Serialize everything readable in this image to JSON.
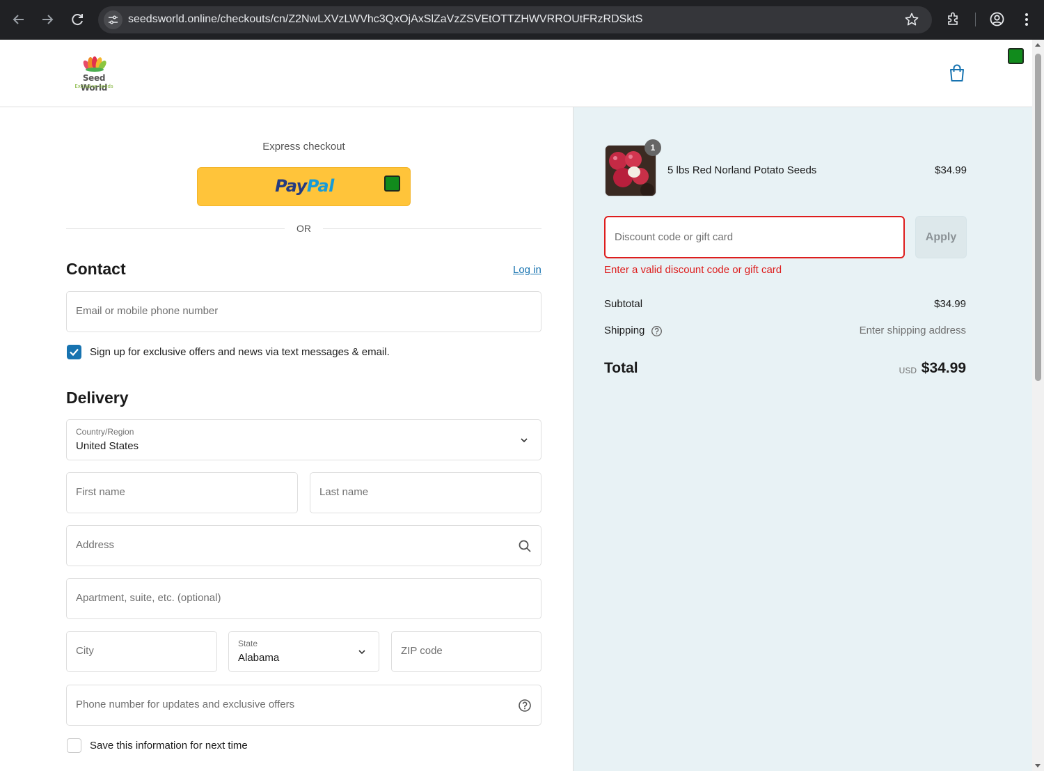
{
  "browser": {
    "url": "seedsworld.online/checkouts/cn/Z2NwLXVzLWVhc3QxOjAxSlZaVzZSVEtOTTZHWVRROUtFRzRDSktS",
    "icons": [
      "back-icon",
      "forward-icon",
      "reload-icon",
      "site-info-icon",
      "star-icon",
      "extensions-icon",
      "profile-icon",
      "menu-icon"
    ]
  },
  "brand": {
    "name": "Seed World",
    "tagline": "Exclusive seeds",
    "accent": "#1773b0",
    "error": "#dd1d1d"
  },
  "express": {
    "title": "Express checkout",
    "paypal_part1": "Pay",
    "paypal_part2": "Pal",
    "divider": "OR"
  },
  "contact": {
    "title": "Contact",
    "login_label": "Log in",
    "email_placeholder": "Email or mobile phone number",
    "marketing_label": "Sign up for exclusive offers and news via text messages & email.",
    "marketing_checked": true
  },
  "delivery": {
    "title": "Delivery",
    "country_label": "Country/Region",
    "country_value": "United States",
    "first_name_placeholder": "First name",
    "last_name_placeholder": "Last name",
    "address_placeholder": "Address",
    "apartment_placeholder": "Apartment, suite, etc. (optional)",
    "city_placeholder": "City",
    "state_label": "State",
    "state_value": "Alabama",
    "zip_placeholder": "ZIP code",
    "phone_placeholder": "Phone number for updates and exclusive offers",
    "save_label": "Save this information for next time",
    "save_checked": false
  },
  "summary": {
    "product": {
      "name": "5 lbs Red Norland Potato Seeds",
      "price": "$34.99",
      "quantity": "1"
    },
    "discount_placeholder": "Discount code or gift card",
    "apply_label": "Apply",
    "error_message": "Enter a valid discount code or gift card",
    "subtotal_label": "Subtotal",
    "subtotal_value": "$34.99",
    "shipping_label": "Shipping",
    "shipping_value": "Enter shipping address",
    "total_label": "Total",
    "total_currency": "USD",
    "total_value": "$34.99"
  }
}
